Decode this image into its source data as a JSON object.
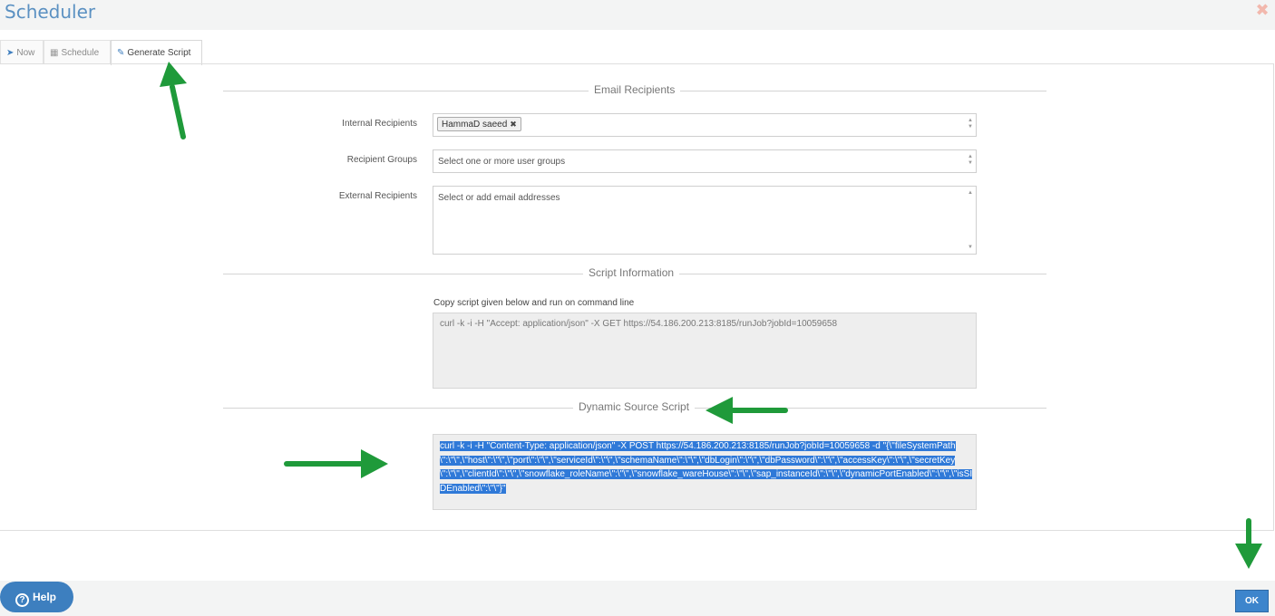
{
  "window": {
    "title": "Scheduler"
  },
  "tabs": [
    {
      "label": "Now",
      "icon": "send-icon"
    },
    {
      "label": "Schedule",
      "icon": "calendar-icon"
    },
    {
      "label": "Generate Script",
      "icon": "script-icon"
    }
  ],
  "email_section": {
    "title": "Email Recipients",
    "internal_label": "Internal Recipients",
    "internal_tag": "HammaD saeed",
    "groups_label": "Recipient Groups",
    "groups_placeholder": "Select one or more user groups",
    "external_label": "External Recipients",
    "external_placeholder": "Select or add email addresses"
  },
  "script_section": {
    "title": "Script Information",
    "hint": "Copy script given below and run on command line",
    "script": "curl -k -i -H \"Accept: application/json\" -X GET https://54.186.200.213:8185/runJob?jobId=10059658"
  },
  "dynamic_section": {
    "title": "Dynamic Source Script",
    "script": "curl -k -i -H \"Content-Type: application/json\" -X POST https://54.186.200.213:8185/runJob?jobId=10059658 -d \"{\\\"fileSystemPath\\\":\\\"\\\",\\\"host\\\":\\\"\\\",\\\"port\\\":\\\"\\\",\\\"serviceId\\\":\\\"\\\",\\\"schemaName\\\":\\\"\\\",\\\"dbLogin\\\":\\\"\\\",\\\"dbPassword\\\":\\\"\\\",\\\"accessKey\\\":\\\"\\\",\\\"secretKey\\\":\\\"\\\",\\\"clientId\\\":\\\"\\\",\\\"snowflake_roleName\\\":\\\"\\\",\\\"snowflake_wareHouse\\\":\\\"\\\",\\\"sap_instanceId\\\":\\\"\\\",\\\"dynamicPortEnabled\\\":\\\"\\\",\\\"isSIDEnabled\\\":\\\"\\\"}\""
  },
  "footer": {
    "help_label": "Help",
    "ok_label": "OK"
  },
  "colors": {
    "title": "#5b91c2",
    "accent": "#3d7fbf",
    "selection": "#2f79d8",
    "annotation_arrow": "#1f9a3a",
    "close": "#f2b8ad"
  }
}
